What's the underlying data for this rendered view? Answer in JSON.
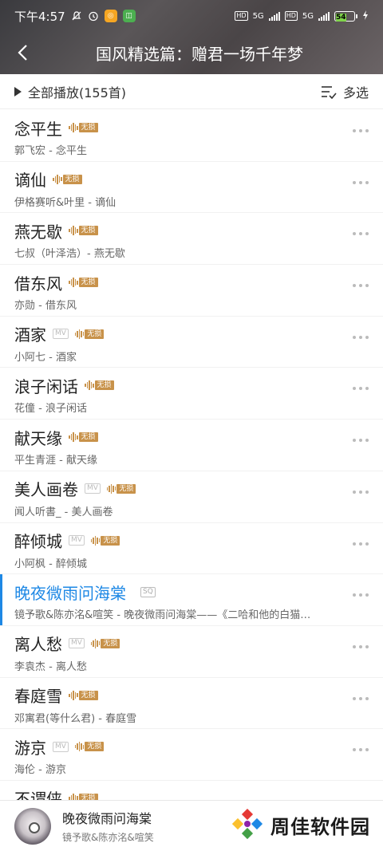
{
  "status": {
    "time": "下午4:57",
    "network1": "5G",
    "network2": "5G",
    "battery": "54",
    "battery_level": 0.54,
    "hd1": "HD",
    "hd2": "HD"
  },
  "header": {
    "title": "国风精选篇：赠君一场千年梦"
  },
  "toolbar": {
    "play_all": "全部播放(155首)",
    "multi_select": "多选"
  },
  "songs": [
    {
      "title": "念平生",
      "subtitle": "郭飞宏 - 念平生",
      "tags": [
        "lossless"
      ]
    },
    {
      "title": "谪仙",
      "subtitle": "伊格赛听&叶里 - 谪仙",
      "tags": [
        "lossless"
      ]
    },
    {
      "title": "燕无歇",
      "subtitle": "七叔（叶泽浩）- 燕无歇",
      "tags": [
        "lossless"
      ]
    },
    {
      "title": "借东风",
      "subtitle": "亦勋 - 借东风",
      "tags": [
        "lossless"
      ]
    },
    {
      "title": "酒家",
      "subtitle": "小阿七 - 酒家",
      "tags": [
        "mv",
        "lossless"
      ]
    },
    {
      "title": "浪子闲话",
      "subtitle": "花僮 - 浪子闲话",
      "tags": [
        "lossless"
      ]
    },
    {
      "title": "献天缘",
      "subtitle": "平生青涯 - 献天缘",
      "tags": [
        "lossless"
      ]
    },
    {
      "title": "美人画卷",
      "subtitle": "闻人听書_ - 美人画卷",
      "tags": [
        "mv",
        "lossless"
      ]
    },
    {
      "title": "醉倾城",
      "subtitle": "小阿枫 - 醉倾城",
      "tags": [
        "mv",
        "lossless"
      ]
    },
    {
      "title": "晚夜微雨问海棠",
      "subtitle": "镜予歌&陈亦洺&喧笑 - 晚夜微雨问海棠——《二哈和他的白猫…",
      "tags": [
        "sq"
      ],
      "active": true
    },
    {
      "title": "离人愁",
      "subtitle": "李袁杰 - 离人愁",
      "tags": [
        "mv",
        "lossless"
      ]
    },
    {
      "title": "春庭雪",
      "subtitle": "邓寓君(等什么君) - 春庭雪",
      "tags": [
        "lossless"
      ]
    },
    {
      "title": "游京",
      "subtitle": "海伦 - 游京",
      "tags": [
        "mv",
        "lossless"
      ]
    },
    {
      "title": "不谓侠",
      "subtitle": "",
      "tags": [
        "lossless"
      ]
    }
  ],
  "tag_labels": {
    "lossless": "无损",
    "mv": "MV",
    "sq": "SQ"
  },
  "player": {
    "title": "晚夜微雨问海棠",
    "artist": "镜予歌&陈亦洺&喧笑"
  },
  "brand": {
    "text": "周佳软件园"
  },
  "colors": {
    "accent": "#1e88e5",
    "lossless_gold": "#c8924a"
  }
}
